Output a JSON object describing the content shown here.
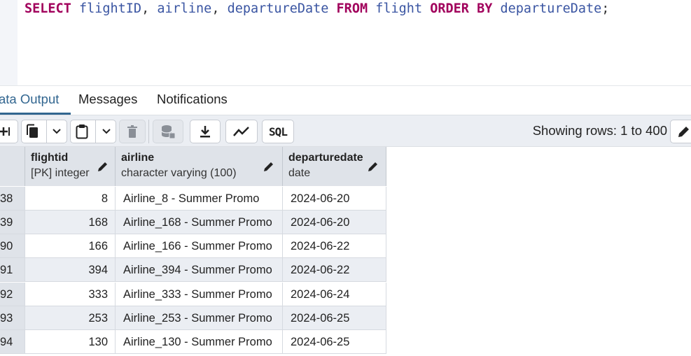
{
  "query": {
    "select_kw": "SELECT",
    "col1": "flightID",
    "col2": "airline",
    "col3": "departureDate",
    "from_kw": "FROM",
    "table": "flight",
    "order_kw": "ORDER",
    "by_kw": "BY",
    "order_col": "departureDate"
  },
  "tabs": [
    {
      "label": "ata Output",
      "active": true
    },
    {
      "label": "Messages",
      "active": false
    },
    {
      "label": "Notifications",
      "active": false
    }
  ],
  "toolbar": {
    "sql_label": "SQL",
    "rows_info": "Showing rows: 1 to 400"
  },
  "columns": [
    {
      "name": "flightid",
      "type": "[PK] integer"
    },
    {
      "name": "airline",
      "type": "character varying (100)"
    },
    {
      "name": "departuredate",
      "type": "date"
    }
  ],
  "rows": [
    {
      "num": "38",
      "flightid": "8",
      "airline": "Airline_8 - Summer Promo",
      "departuredate": "2024-06-20"
    },
    {
      "num": "39",
      "flightid": "168",
      "airline": "Airline_168 - Summer Promo",
      "departuredate": "2024-06-20"
    },
    {
      "num": "90",
      "flightid": "166",
      "airline": "Airline_166 - Summer Promo",
      "departuredate": "2024-06-22"
    },
    {
      "num": "91",
      "flightid": "394",
      "airline": "Airline_394 - Summer Promo",
      "departuredate": "2024-06-22"
    },
    {
      "num": "92",
      "flightid": "333",
      "airline": "Airline_333 - Summer Promo",
      "departuredate": "2024-06-24"
    },
    {
      "num": "93",
      "flightid": "253",
      "airline": "Airline_253 - Summer Promo",
      "departuredate": "2024-06-25"
    },
    {
      "num": "94",
      "flightid": "130",
      "airline": "Airline_130 - Summer Promo",
      "departuredate": "2024-06-25"
    }
  ],
  "icons": {
    "add_row": "add-row-icon",
    "copy": "copy-icon",
    "paste": "paste-icon",
    "delete": "trash-icon",
    "save_data": "save-data-icon",
    "download": "download-icon",
    "graph": "graph-icon",
    "edit": "pencil-icon"
  },
  "colors": {
    "keyword": "#a1005c",
    "identifier": "#3a55a2",
    "active_tab": "#326690"
  }
}
